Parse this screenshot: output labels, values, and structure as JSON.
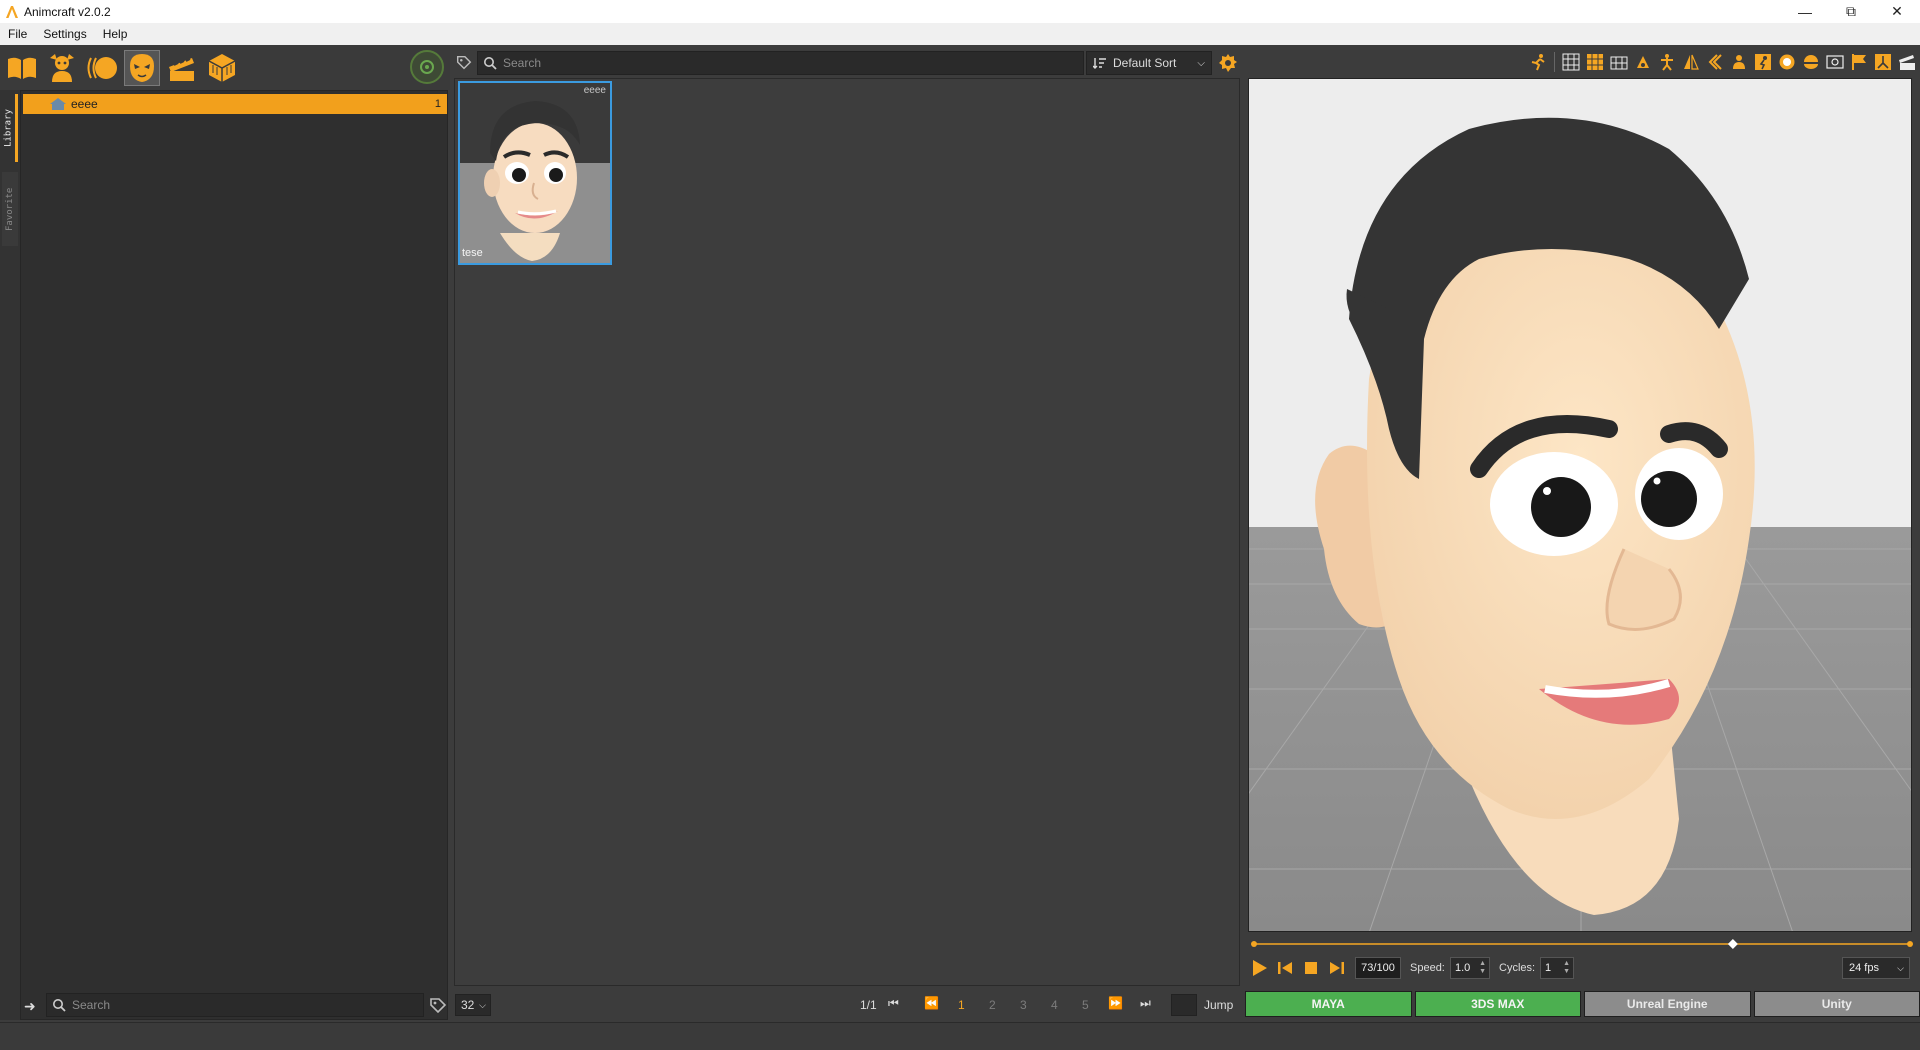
{
  "window": {
    "title": "Animcraft v2.0.2",
    "controls": [
      "minimize-icon",
      "restore-icon",
      "close-icon"
    ]
  },
  "menubar": {
    "items": [
      "File",
      "Settings",
      "Help"
    ]
  },
  "toolbar": {
    "icons": [
      "book-icon",
      "character-icon",
      "expression-icon",
      "face-icon",
      "clapboard-icon",
      "cube-icon"
    ],
    "active": "face-icon"
  },
  "sidetabs": {
    "library": "Library",
    "favorite": "Favorite"
  },
  "tree": {
    "items": [
      {
        "name": "eeee",
        "count": "1"
      }
    ]
  },
  "library_search": {
    "placeholder": "Search"
  },
  "asset_search": {
    "placeholder": "Search"
  },
  "sort": {
    "label": "Default Sort"
  },
  "assets": [
    {
      "name": "tese",
      "folder": "eeee",
      "selected": true
    }
  ],
  "pagination": {
    "page_size": "32",
    "info": "1/1",
    "pages": [
      "1",
      "2",
      "3",
      "4",
      "5"
    ],
    "current": "1",
    "jump_label": "Jump"
  },
  "player": {
    "frame": "73/100",
    "progress": 0.73,
    "speed_label": "Speed:",
    "speed": "1.0",
    "cycles_label": "Cycles:",
    "cycles": "1",
    "fps": "24 fps"
  },
  "exports": [
    {
      "label": "MAYA",
      "enabled": true
    },
    {
      "label": "3DS MAX",
      "enabled": true
    },
    {
      "label": "Unreal Engine",
      "enabled": false
    },
    {
      "label": "Unity",
      "enabled": false
    }
  ],
  "colors": {
    "accent": "#f5a623",
    "selection": "#3b9be0",
    "export_on": "#4caf50",
    "export_off": "#8c8c8c"
  }
}
